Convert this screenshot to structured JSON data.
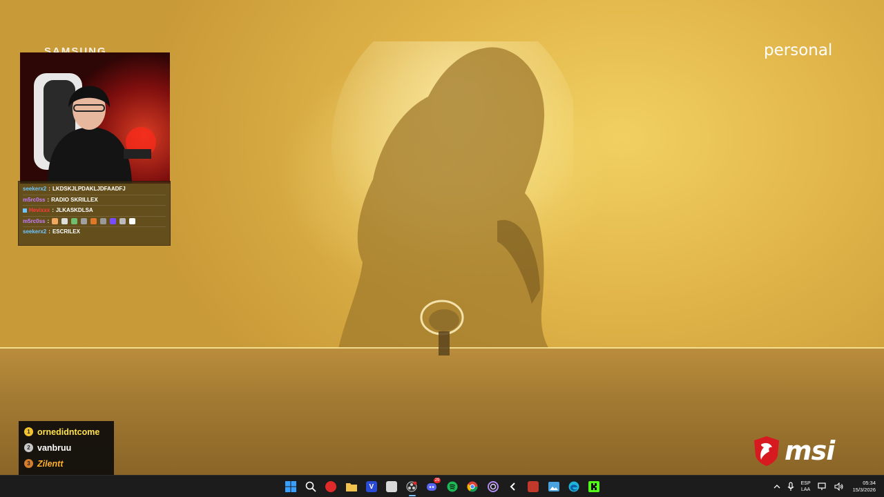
{
  "stream": {
    "sponsor_left": "SAMSUNG",
    "sponsor_right": "personal",
    "brand_logo": "msi"
  },
  "chat": {
    "messages": [
      {
        "user": "seekerx2",
        "text": "LKDSKJLPDAKLJDFAADFJ",
        "user_color": "#6ec6ff"
      },
      {
        "user": "m5rc0ss",
        "text": "RADIO SKRILLEX",
        "user_color": "#c77dff"
      },
      {
        "user": "Hevixxx",
        "text": "JLKASKDLSA",
        "user_color": "#ff3b3b"
      },
      {
        "user": "m5rc0ss",
        "text": "",
        "user_color": "#c77dff",
        "emotes": [
          "emote",
          "emote",
          "emote",
          "emote",
          "emote",
          "emote",
          "emote",
          "emote",
          "emote"
        ]
      },
      {
        "user": "seekerx2",
        "text": "ESCRILEX",
        "user_color": "#6ec6ff"
      }
    ]
  },
  "top_viewers": [
    {
      "rank": "1",
      "name": "ornedidntcome"
    },
    {
      "rank": "2",
      "name": "vanbruu"
    },
    {
      "rank": "3",
      "name": "Zilentt"
    }
  ],
  "taskbar": {
    "apps": [
      {
        "name": "start-icon",
        "color": "#3aa0ff"
      },
      {
        "name": "search-icon",
        "color": "#ffffff"
      },
      {
        "name": "app-red-icon",
        "color": "#e02a2a"
      },
      {
        "name": "file-explorer-icon",
        "color": "#f2c14e"
      },
      {
        "name": "v-app-icon",
        "color": "#2b4bd6"
      },
      {
        "name": "app-gray-icon",
        "color": "#d9d9d9"
      },
      {
        "name": "obs-icon",
        "color": "#7a7a7a"
      },
      {
        "name": "discord-icon",
        "color": "#5865f2"
      },
      {
        "name": "spotify-icon",
        "color": "#1db954"
      },
      {
        "name": "chrome-icon",
        "color": "#f4b400"
      },
      {
        "name": "app-spiral-icon",
        "color": "#b28cf0"
      },
      {
        "name": "app-arrow-icon",
        "color": "#ffffff"
      },
      {
        "name": "voicemeeter-icon",
        "color": "#c0392b"
      },
      {
        "name": "photos-icon",
        "color": "#4aa3df"
      },
      {
        "name": "edge-icon",
        "color": "#1fb3d7"
      },
      {
        "name": "kick-icon",
        "color": "#53fc18"
      }
    ],
    "discord_badge": "29",
    "language_top": "ESP",
    "language_bottom": "LAA",
    "time": "05:34",
    "date": "15/3/2026"
  }
}
